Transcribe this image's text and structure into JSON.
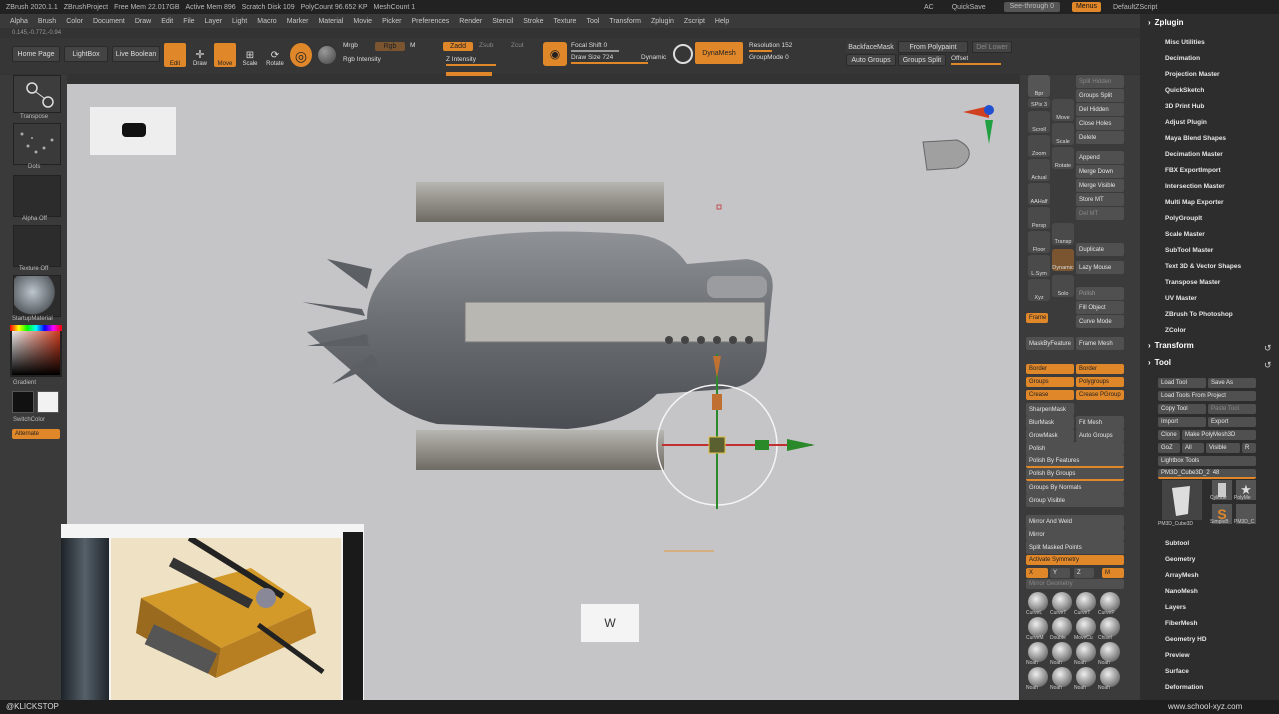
{
  "titlebar": {
    "app": "ZBrush 2020.1.1",
    "project": "ZBrushProject",
    "free_mem": "Free Mem 22.017GB",
    "active_mem": "Active Mem 896",
    "scratch": "Scratch Disk 109",
    "polycount": "PolyCount 96.652 KP",
    "meshcount": "MeshCount 1",
    "ac": "AC",
    "quicksave": "QuickSave",
    "see_through": "See-through 0",
    "menus": "Menus",
    "default_script": "DefaultZScript"
  },
  "menubar": [
    "Alpha",
    "Brush",
    "Color",
    "Document",
    "Draw",
    "Edit",
    "File",
    "Layer",
    "Light",
    "Macro",
    "Marker",
    "Material",
    "Movie",
    "Picker",
    "Preferences",
    "Render",
    "Stencil",
    "Stroke",
    "Texture",
    "Tool",
    "Transform",
    "Zplugin",
    "Zscript",
    "Help"
  ],
  "path_text": "0.145,-0.772,-0.94",
  "shelf": {
    "home": "Home Page",
    "lightbox": "LightBox",
    "live_boolean": "Live Boolean",
    "edit": "Edit",
    "draw": "Draw",
    "move": "Move",
    "scale": "Scale",
    "rotate": "Rotate",
    "mrgb": "Mrgb",
    "rgb": "Rgb",
    "m": "M",
    "zadd": "Zadd",
    "zsub": "Zsub",
    "zcut": "Zcut",
    "zintensity": "Z Intensity",
    "rgb_intensity": "Rgb Intensity",
    "focal_shift": "Focal Shift 0",
    "draw_size": "Draw Size 724",
    "dynamic": "Dynamic",
    "dynamesh": "DynaMesh",
    "resolution": "Resolution 152",
    "group_mode": "GroupMode 0",
    "backface_mask": "BackfaceMask",
    "from_polypaint": "From Polypaint",
    "del_lower": "Del Lower",
    "auto_groups": "Auto Groups",
    "groups_split": "Groups Split",
    "offset": "Offset"
  },
  "left": {
    "transpose": "Transpose",
    "dots": "Dots",
    "alpha_off": "Alpha Off",
    "texture_off": "Texture Off",
    "material": "StartupMaterial",
    "gradient": "Gradient",
    "switch_color": "SwitchColor",
    "alternate": "Alternate"
  },
  "canvas": {
    "key_hint": "W"
  },
  "right_shelf": {
    "icons": [
      "Bpr",
      "SPix 3",
      "Scroll",
      "Zoom",
      "Actual",
      "AAHalf",
      "Persp",
      "Floor",
      "L.Sym",
      "Xyz",
      "Frame",
      "Move",
      "Scale",
      "Rotate",
      "Transp",
      "Dynamic",
      "Solo"
    ],
    "buttons": [
      "Split Hidden",
      "Groups Split",
      "Del Hidden",
      "Close Holes",
      "Delete",
      "Append",
      "Merge Down",
      "Merge Visible",
      "Store MT",
      "Del MT",
      "Duplicate",
      "Lazy Mouse",
      "Polish",
      "Fill Object",
      "Curve Mode",
      "MaskByFeature",
      "Frame Mesh"
    ],
    "orange_labels": [
      "Border",
      "Border",
      "Groups",
      "Polygroups",
      "Crease",
      "Crease PGroup"
    ],
    "lower": [
      "SharpenMask",
      "BlurMask",
      "Fit Mesh",
      "GrowMask",
      "Auto Groups",
      "Polish",
      "Polish By Features",
      "Polish By Groups",
      "Groups By Normals",
      "Group Visible",
      "Mirror And Weld",
      "Mirror",
      "Split Masked Points",
      "Activate Symmetry",
      "Mirror Geometry"
    ],
    "sym": [
      "X",
      "Y",
      "Z",
      "M"
    ],
    "brushes": [
      "CurveL",
      "CurveT",
      "CurveT",
      "CurveP",
      "CurveM",
      "Double",
      "MoveCu",
      "Chisel",
      "Noah",
      "Noah",
      "Noah",
      "Noah",
      "Noah",
      "Noah",
      "Noah",
      "Noah"
    ]
  },
  "zplugin": {
    "title": "Zplugin",
    "items": [
      "Misc Utilities",
      "Decimation",
      "Projection Master",
      "QuickSketch",
      "3D Print Hub",
      "Adjust Plugin",
      "Maya Blend Shapes",
      "Decimation Master",
      "FBX ExportImport",
      "Intersection Master",
      "Multi Map Exporter",
      "PolyGroupIt",
      "Scale Master",
      "SubTool Master",
      "Text 3D & Vector Shapes",
      "Transpose Master",
      "UV Master",
      "ZBrush To Photoshop",
      "ZColor"
    ],
    "transform": "Transform",
    "tool": "Tool",
    "tool_buttons": [
      "Load Tool",
      "Save As",
      "Load Tools From Project",
      "Copy Tool",
      "Paste Tool",
      "Import",
      "Export",
      "Clone",
      "Make PolyMesh3D",
      "GoZ",
      "All",
      "Visible",
      "R",
      "Lightbox Tools"
    ],
    "current_tool": "PM3D_Cube3D_2",
    "current_tool_value": "48",
    "tool_thumbs": [
      "PM3D_Cube3D",
      "Cylinde",
      "PolyMe",
      "SimpleB",
      "PM3D_C"
    ],
    "subpalettes": [
      "Subtool",
      "Geometry",
      "ArrayMesh",
      "NanoMesh",
      "Layers",
      "FiberMesh",
      "Geometry HD",
      "Preview",
      "Surface",
      "Deformation"
    ]
  },
  "status": {
    "left": "@KLICKSTOP",
    "right": "www.school-xyz.com"
  },
  "colors": {
    "accent": "#e0872a",
    "canvas": "#c5c5c8",
    "panel": "#3a3a3a"
  }
}
